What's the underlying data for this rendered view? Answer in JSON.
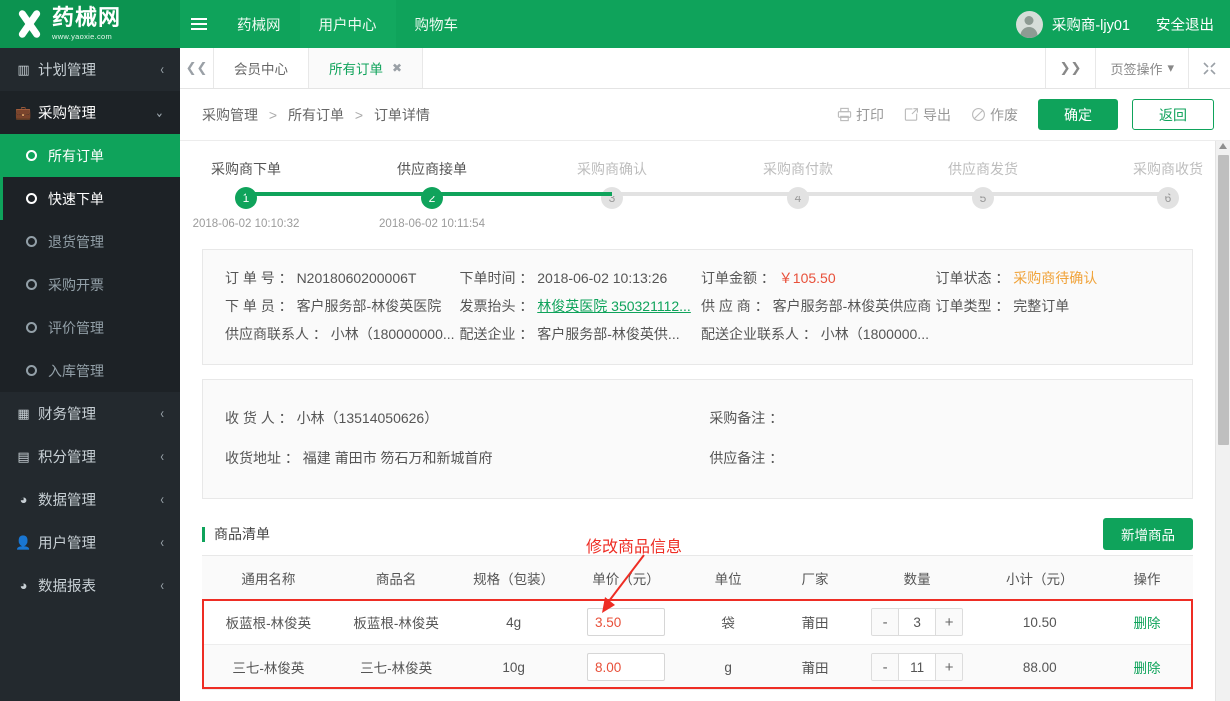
{
  "brand": {
    "name_cn": "药械网",
    "url": "www.yaoxie.com",
    "accent": "#0fa35b"
  },
  "topnav": {
    "menu_icon": "hamburger-icon",
    "items": [
      {
        "label": "药械网",
        "active": false
      },
      {
        "label": "用户中心",
        "active": true
      },
      {
        "label": "购物车",
        "active": false
      }
    ],
    "user": "采购商-ljy01",
    "logout": "安全退出"
  },
  "sidebar": {
    "groups": [
      {
        "label": "计划管理",
        "icon": "chart-bar-icon",
        "state": "collapsed",
        "chevron": "‹",
        "items": []
      },
      {
        "label": "采购管理",
        "icon": "briefcase-icon",
        "state": "expanded",
        "chevron": "⌄",
        "items": [
          {
            "label": "所有订单",
            "active": true
          },
          {
            "label": "快速下单",
            "current": true
          },
          {
            "label": "退货管理"
          },
          {
            "label": "采购开票"
          },
          {
            "label": "评价管理"
          },
          {
            "label": "入库管理"
          }
        ]
      },
      {
        "label": "财务管理",
        "icon": "grid-icon",
        "state": "collapsed",
        "chevron": "‹",
        "items": []
      },
      {
        "label": "积分管理",
        "icon": "database-icon",
        "state": "collapsed",
        "chevron": "‹",
        "items": []
      },
      {
        "label": "数据管理",
        "icon": "pie-chart-icon",
        "state": "collapsed",
        "chevron": "‹",
        "items": []
      },
      {
        "label": "用户管理",
        "icon": "user-icon",
        "state": "collapsed",
        "chevron": "‹",
        "items": []
      },
      {
        "label": "数据报表",
        "icon": "pie-chart-icon",
        "state": "collapsed",
        "chevron": "‹",
        "items": []
      }
    ]
  },
  "tabstrip": {
    "prev_icon": "double-chevron-left-icon",
    "next_icon": "double-chevron-right-icon",
    "tabs": [
      {
        "label": "会员中心",
        "active": false,
        "closable": false
      },
      {
        "label": "所有订单",
        "active": true,
        "closable": true,
        "close_glyph": "✖"
      }
    ],
    "tab_ops_label": "页签操作",
    "tab_ops_caret": "▾",
    "fullscreen_icon": "expand-icon"
  },
  "breadcrumb": {
    "items": [
      "采购管理",
      "所有订单",
      "订单详情"
    ],
    "separator": ">"
  },
  "actions": {
    "print": "打印",
    "export": "导出",
    "void": "作废",
    "confirm": "确定",
    "back": "返回"
  },
  "steps": [
    {
      "label": "采购商下单",
      "num": "1",
      "done": true,
      "time": "2018-06-02 10:10:32"
    },
    {
      "label": "供应商接单",
      "num": "2",
      "done": true,
      "time": "2018-06-02 10:11:54"
    },
    {
      "label": "采购商确认",
      "num": "3",
      "done": false,
      "time": ""
    },
    {
      "label": "采购商付款",
      "num": "4",
      "done": false,
      "time": ""
    },
    {
      "label": "供应商发货",
      "num": "5",
      "done": false,
      "time": ""
    },
    {
      "label": "采购商收货",
      "num": "6",
      "done": false,
      "time": ""
    }
  ],
  "order_info": {
    "order_no_label": "订 单 号",
    "order_no": "N2018060200006T",
    "order_time_label": "下单时间",
    "order_time": "2018-06-02 10:13:26",
    "amount_label": "订单金额",
    "amount": "￥105.50",
    "status_label": "订单状态",
    "status": "采购商待确认",
    "operator_label": "下 单 员",
    "operator": "客户服务部-林俊英医院",
    "invoice_label": "发票抬头",
    "invoice": "林俊英医院 350321112...",
    "supplier_label": "供 应 商",
    "supplier": "客户服务部-林俊英供应商",
    "order_type_label": "订单类型",
    "order_type": "完整订单",
    "supplier_contact_label": "供应商联系人",
    "supplier_contact": "小林（180000000...",
    "delivery_company_label": "配送企业",
    "delivery_company": "客户服务部-林俊英供...",
    "delivery_contact_label": "配送企业联系人",
    "delivery_contact": "小林（1800000..."
  },
  "receiver_info": {
    "receiver_label": "收 货 人",
    "receiver": "小林（13514050626）",
    "purchase_note_label": "采购备注",
    "purchase_note": "",
    "address_label": "收货地址",
    "address": "福建 莆田市 笏石万和新城首府",
    "supply_note_label": "供应备注",
    "supply_note": ""
  },
  "goods": {
    "section_title": "商品清单",
    "add_button": "新增商品",
    "annotation": "修改商品信息",
    "annotation_color": "#ee2d24",
    "columns": [
      "通用名称",
      "商品名",
      "规格（包装）",
      "单价（元）",
      "单位",
      "厂家",
      "数量",
      "小计（元）",
      "操作"
    ],
    "rows": [
      {
        "generic_name": "板蓝根-林俊英",
        "product_name": "板蓝根-林俊英",
        "spec": "4g",
        "unit_price": "3.50",
        "unit": "袋",
        "factory": "莆田",
        "qty": "3",
        "subtotal": "10.50",
        "action": "删除",
        "minus": "-",
        "plus": "+"
      },
      {
        "generic_name": "三七-林俊英",
        "product_name": "三七-林俊英",
        "spec": "10g",
        "unit_price": "8.00",
        "unit": "g",
        "factory": "莆田",
        "qty": "11",
        "subtotal": "88.00",
        "action": "删除",
        "minus": "-",
        "plus": "+"
      }
    ]
  }
}
